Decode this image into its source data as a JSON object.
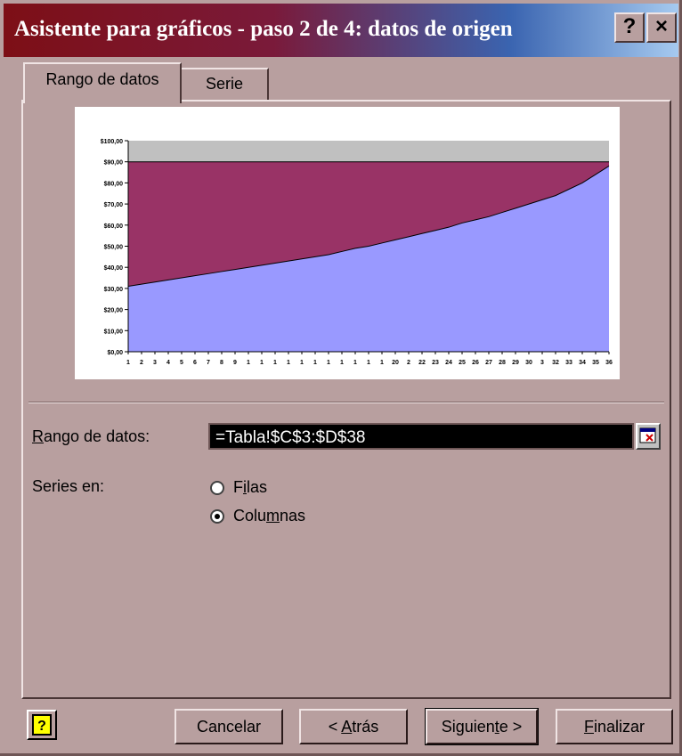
{
  "window": {
    "title": "Asistente para gráficos - paso 2 de 4: datos de origen",
    "help_glyph": "?",
    "close_glyph": "×"
  },
  "tabs": [
    {
      "label": "Rango de datos",
      "active": true
    },
    {
      "label": "Serie",
      "active": false
    }
  ],
  "chart_data": {
    "type": "area",
    "title": "",
    "x": [
      "1",
      "2",
      "3",
      "4",
      "5",
      "6",
      "7",
      "8",
      "9",
      "1",
      "1",
      "1",
      "1",
      "1",
      "1",
      "1",
      "1",
      "1",
      "1",
      "1",
      "20",
      "2",
      "22",
      "23",
      "24",
      "25",
      "26",
      "27",
      "28",
      "29",
      "30",
      "3",
      "32",
      "33",
      "34",
      "35",
      "36"
    ],
    "y_ticks": [
      "$100,00",
      "$90,00",
      "$80,00",
      "$70,00",
      "$60,00",
      "$50,00",
      "$40,00",
      "$30,00",
      "$20,00",
      "$10,00",
      "$0,00"
    ],
    "ylim": [
      0,
      100
    ],
    "series": [
      {
        "color": "#9999ff",
        "values": [
          31,
          32,
          33,
          34,
          35,
          36,
          37,
          38,
          39,
          40,
          41,
          42,
          43,
          44,
          45,
          46,
          47.5,
          49,
          50,
          51.5,
          53,
          54.5,
          56,
          57.5,
          59,
          61,
          62.5,
          64,
          66,
          68,
          70,
          72,
          74,
          77,
          80,
          84,
          88
        ]
      },
      {
        "color": "#993366",
        "values": [
          59,
          58,
          57,
          56,
          55,
          54,
          53,
          52,
          51,
          50,
          49,
          48,
          47,
          46,
          45,
          44,
          42.5,
          41,
          40,
          38.5,
          37,
          35.5,
          34,
          32.5,
          31,
          29,
          27.5,
          26,
          24,
          22,
          20,
          18,
          16,
          13,
          10,
          6,
          2
        ]
      }
    ],
    "colors": {
      "plot_bg": "#c0c0c0",
      "series1": "#9999ff",
      "series2": "#993366"
    }
  },
  "form": {
    "range_label_u": "R",
    "range_label_rest": "ango de datos:",
    "range_value": "=Tabla!$C$3:$D$38",
    "series_label": "Series en:",
    "option_rows": {
      "pre": "F",
      "u": "i",
      "post": "las",
      "selected": false
    },
    "option_cols": {
      "pre": "Colu",
      "u": "m",
      "post": "nas",
      "selected": true
    }
  },
  "buttons": {
    "cancel": "Cancelar",
    "back_pre": "< ",
    "back_u": "A",
    "back_post": "trás",
    "next_pre": "Siguien",
    "next_u": "t",
    "next_post": "e >",
    "finish_u": "F",
    "finish_post": "inalizar"
  }
}
